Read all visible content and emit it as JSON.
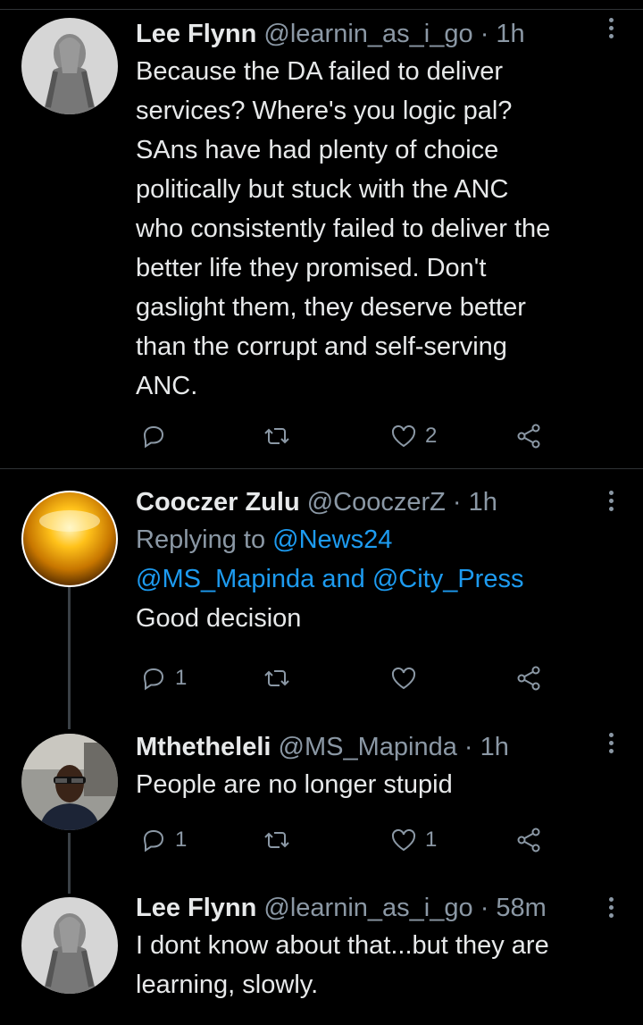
{
  "colors": {
    "background": "#000000",
    "link": "#1d9bf0",
    "muted": "#8b98a5",
    "text": "#e7e9ea"
  },
  "tweets": [
    {
      "name": "Lee Flynn",
      "meta": "@learnin_as_i_go · 1h",
      "lines": [
        "Because the DA failed to deliver",
        "services? Where's you logic pal?",
        "SAns have had plenty of choice",
        "politically but stuck with the ANC",
        "who consistently failed to deliver the",
        "better life they promised. Don't",
        "gaslight them, they deserve better",
        "than the corrupt and self-serving",
        "ANC."
      ],
      "reply_count": "",
      "retweet_count": "",
      "like_count": "2"
    },
    {
      "name": "Cooczer Zulu",
      "meta": "@CooczerZ · 1h",
      "replying_prefix": "Replying to ",
      "replying_user1": "@News24",
      "replying_user2": "@MS_Mapinda",
      "replying_and": " and ",
      "replying_user3": "@City_Press",
      "text": "Good decision",
      "reply_count": "1",
      "retweet_count": "",
      "like_count": ""
    },
    {
      "name": "Mthetheleli",
      "meta": "@MS_Mapinda · 1h",
      "text": "People are no longer stupid",
      "reply_count": "1",
      "retweet_count": "",
      "like_count": "1"
    },
    {
      "name": "Lee Flynn",
      "meta": "@learnin_as_i_go · 58m",
      "lines": [
        "I dont know about that...but they are",
        "learning, slowly."
      ]
    }
  ]
}
